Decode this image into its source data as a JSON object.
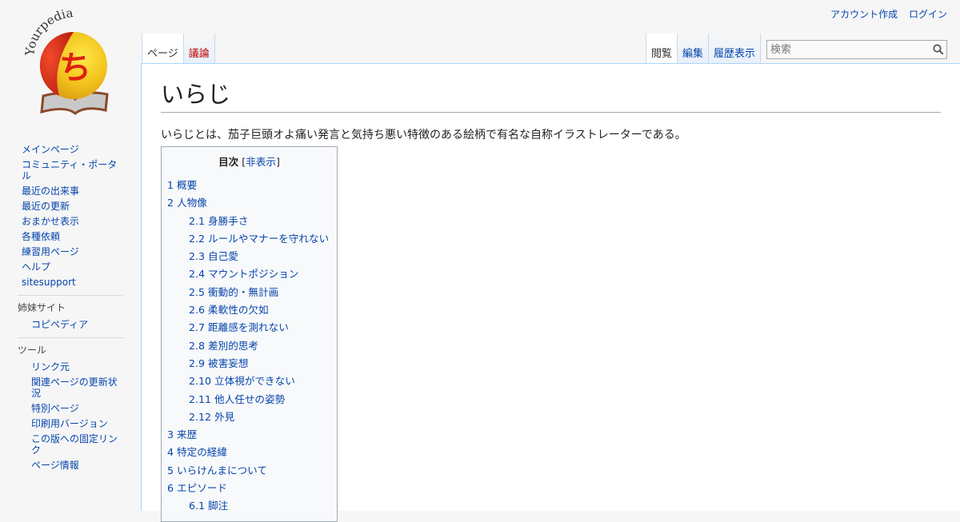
{
  "personal": {
    "create_account": "アカウント作成",
    "login": "ログイン"
  },
  "logo": {
    "wordmark": "Yourpedia",
    "glyph": "ち"
  },
  "nav": {
    "main": [
      "メインページ",
      "コミュニティ・ポータル",
      "最近の出来事",
      "最近の更新",
      "おまかせ表示",
      "各種依頼",
      "練習用ページ",
      "ヘルプ",
      "sitesupport"
    ],
    "sister_title": "姉妹サイト",
    "sister": [
      "コピペディア"
    ],
    "tools_title": "ツール",
    "tools": [
      "リンク元",
      "関連ページの更新状況",
      "特別ページ",
      "印刷用バージョン",
      "この版への固定リンク",
      "ページ情報"
    ]
  },
  "tabs": {
    "page": "ページ",
    "talk": "議論",
    "read": "閲覧",
    "edit": "編集",
    "history": "履歴表示"
  },
  "search": {
    "placeholder": "検索"
  },
  "article": {
    "title": "いらじ",
    "intro": "いらじとは、茄子巨頭オよ痛い発言と気持ち悪い特徴のある絵柄で有名な自称イラストレーターである。"
  },
  "toc": {
    "title": "目次",
    "toggle_open": "[",
    "toggle": "非表示",
    "toggle_close": "]",
    "items": [
      {
        "num": "1",
        "text": "概要",
        "level": 1
      },
      {
        "num": "2",
        "text": "人物像",
        "level": 1
      },
      {
        "num": "2.1",
        "text": "身勝手さ",
        "level": 2
      },
      {
        "num": "2.2",
        "text": "ルールやマナーを守れない",
        "level": 2
      },
      {
        "num": "2.3",
        "text": "自己愛",
        "level": 2
      },
      {
        "num": "2.4",
        "text": "マウントポジション",
        "level": 2
      },
      {
        "num": "2.5",
        "text": "衝動的・無計画",
        "level": 2
      },
      {
        "num": "2.6",
        "text": "柔軟性の欠如",
        "level": 2
      },
      {
        "num": "2.7",
        "text": "距離感を測れない",
        "level": 2
      },
      {
        "num": "2.8",
        "text": "差別的思考",
        "level": 2
      },
      {
        "num": "2.9",
        "text": "被害妄想",
        "level": 2
      },
      {
        "num": "2.10",
        "text": "立体視ができない",
        "level": 2
      },
      {
        "num": "2.11",
        "text": "他人任せの姿勢",
        "level": 2
      },
      {
        "num": "2.12",
        "text": "外見",
        "level": 2
      },
      {
        "num": "3",
        "text": "来歴",
        "level": 1
      },
      {
        "num": "4",
        "text": "特定の経緯",
        "level": 1
      },
      {
        "num": "5",
        "text": "いらけんまについて",
        "level": 1
      },
      {
        "num": "6",
        "text": "エピソード",
        "level": 1
      },
      {
        "num": "6.1",
        "text": "脚注",
        "level": 2
      }
    ]
  },
  "colors": {
    "link": "#0645ad",
    "new_link": "#ba0000",
    "border": "#a7d7f9"
  },
  "icons": {
    "search": "search-icon"
  }
}
